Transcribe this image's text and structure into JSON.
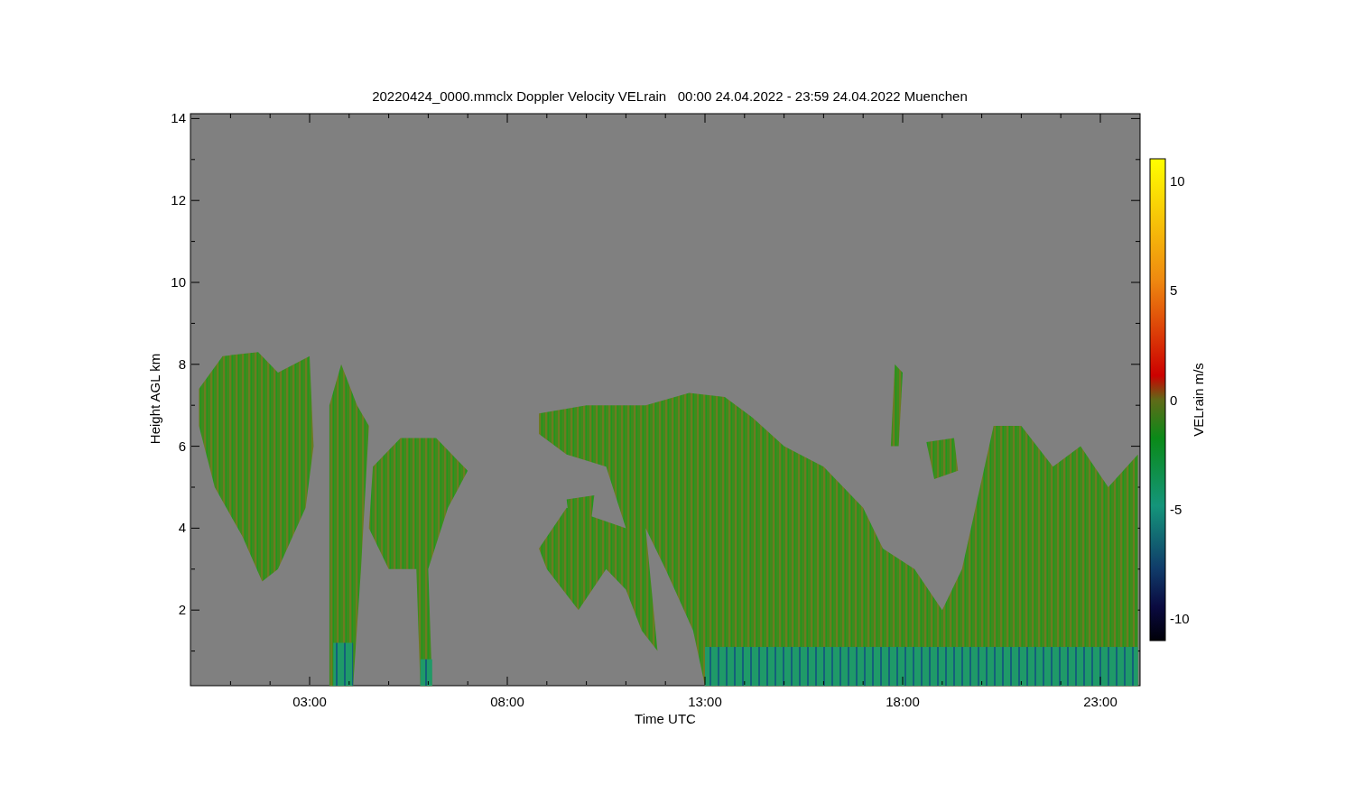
{
  "title": "20220424_0000.mmclx Doppler Velocity VELrain   00:00 24.04.2022 - 23:59 24.04.2022 Muenchen",
  "plot": {
    "xlabel": "Time UTC",
    "ylabel": "Height AGL km",
    "xticks": [
      "03:00",
      "08:00",
      "13:00",
      "18:00",
      "23:00"
    ],
    "yticks": [
      "14",
      "12",
      "10",
      "8",
      "6",
      "4",
      "2"
    ]
  },
  "colorbar": {
    "label": "VELrain m/s",
    "ticks": [
      "10",
      "5",
      "0",
      "-5",
      "-10"
    ]
  }
}
